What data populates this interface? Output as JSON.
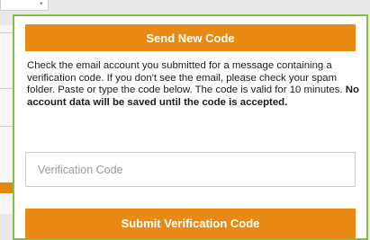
{
  "background": {
    "dropdown_arrow": "▾"
  },
  "dialog": {
    "send_button_label": "Send New Code",
    "message_text": "Check the email account you submitted for a message containing a verification code. If you don't see the email, please check your spam folder. Paste or type the code below. The code is valid for 10 minutes. ",
    "message_emphasis": "No account data will be saved until the code is accepted.",
    "code_input": {
      "placeholder": "Verification Code",
      "value": ""
    },
    "submit_button_label": "Submit Verification Code"
  },
  "colors": {
    "accent": "#e88a14",
    "focus_border": "#7fc04a"
  }
}
